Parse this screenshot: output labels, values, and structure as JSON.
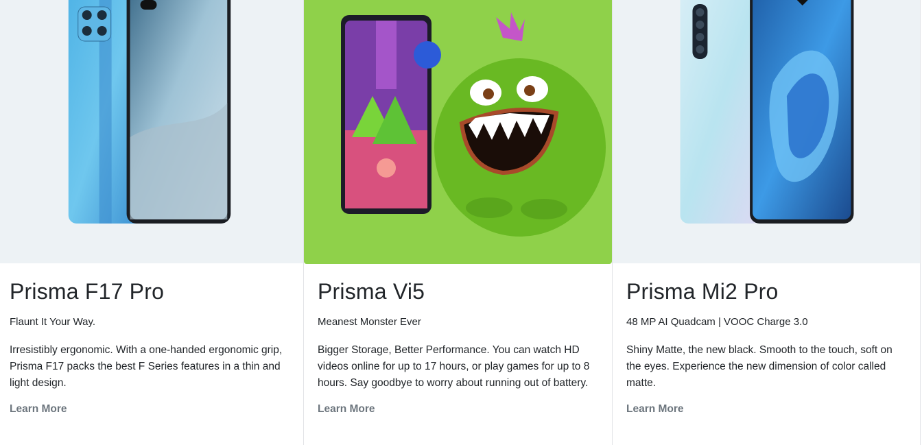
{
  "cards": [
    {
      "title": "Prisma F17 Pro",
      "tagline": "Flaunt It Your Way.",
      "description": "Irresistibly ergonomic. With a one-handed ergonomic grip, Prisma F17 packs the best F Series features in a thin and light design.",
      "link": "Learn More",
      "image": "blue-phone-front-and-back-photo"
    },
    {
      "title": "Prisma Vi5",
      "tagline": "Meanest Monster Ever",
      "description": "Bigger Storage, Better Performance. You can watch HD videos online for up to 17 hours, or play games for up to 8 hours. Say goodbye to worry about running out of battery.",
      "link": "Learn More",
      "image": "phone-with-green-furry-monster-photo"
    },
    {
      "title": "Prisma Mi2 Pro",
      "tagline": "48 MP AI Quadcam | VOOC Charge 3.0",
      "description": "Shiny Matte, the new black. Smooth to the touch, soft on the eyes. Experience the new dimension of color called matte.",
      "link": "Learn More",
      "image": "light-blue-phone-front-and-back-photo"
    }
  ],
  "colors": {
    "media_bg_light": "#edf2f5",
    "media_bg_green": "#8fd14a",
    "link": "#6c757d",
    "text": "#212529"
  }
}
